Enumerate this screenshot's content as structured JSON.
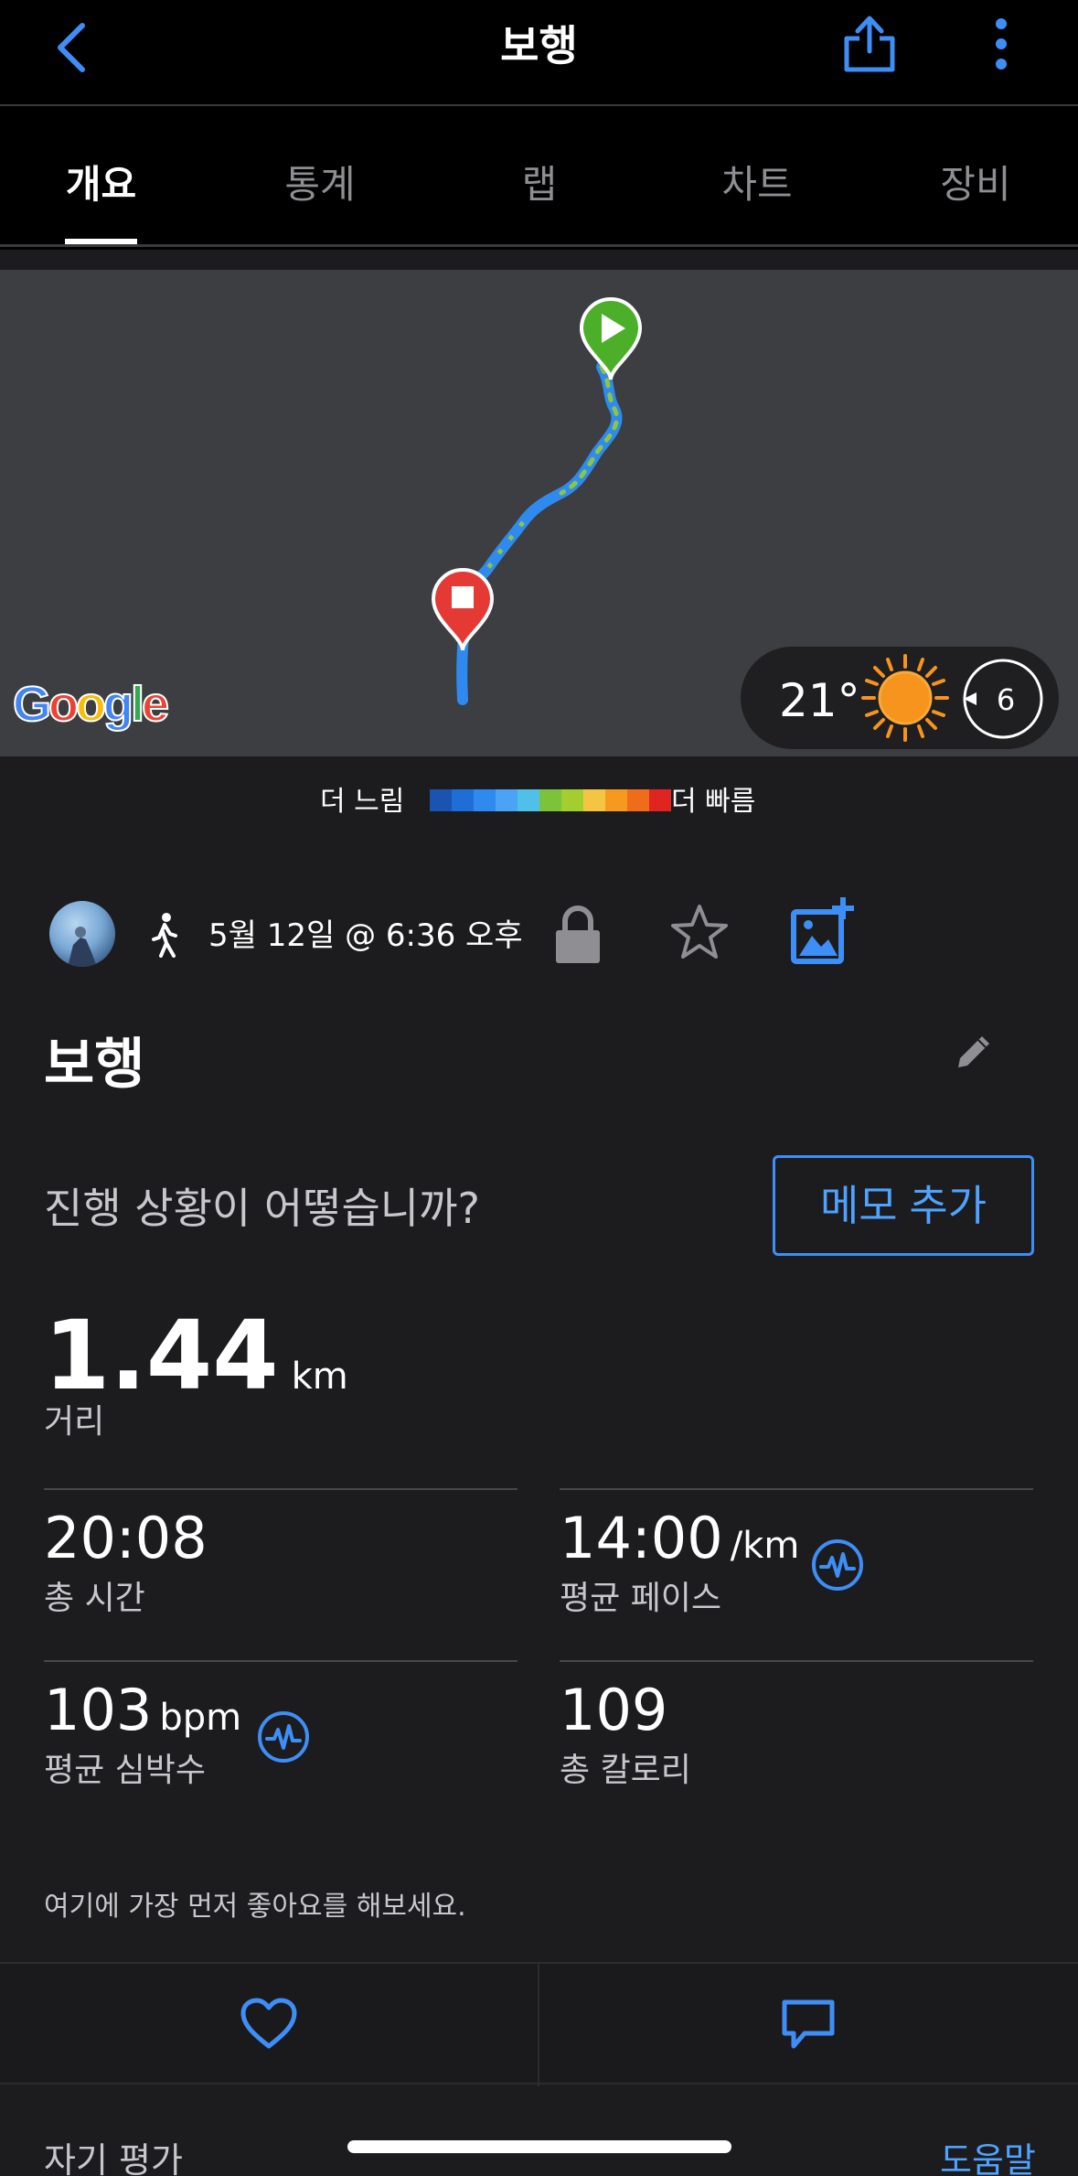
{
  "header": {
    "title": "보행",
    "back_icon": "chevron-left-icon",
    "share_icon": "share-icon",
    "more_icon": "more-vertical-icon"
  },
  "tabs": [
    {
      "label": "개요",
      "active": true
    },
    {
      "label": "통계",
      "active": false
    },
    {
      "label": "랩",
      "active": false
    },
    {
      "label": "차트",
      "active": false
    },
    {
      "label": "장비",
      "active": false
    }
  ],
  "map": {
    "google_logo": "Google",
    "weather": {
      "temperature": "21°",
      "wind": "6",
      "condition_icon": "sun-icon"
    }
  },
  "pace_legend": {
    "slow_label": "더 느림",
    "fast_label": "더 빠름",
    "colors": [
      "#1a53b0",
      "#1f6ed8",
      "#2f8af0",
      "#4aa3f5",
      "#4fc0e8",
      "#7cc23a",
      "#a3cf2e",
      "#f4c542",
      "#f59a1e",
      "#ef6c1a",
      "#e0241f"
    ]
  },
  "activity": {
    "date": "5월 12일 @ 6:36 오후",
    "title": "보행",
    "question": "진행 상황이 어떻습니까?",
    "memo_button": "메모 추가"
  },
  "stats": {
    "distance": {
      "value": "1.44",
      "unit": "km",
      "label": "거리"
    },
    "total_time": {
      "value": "20:08",
      "label": "총 시간"
    },
    "avg_pace": {
      "value": "14:00",
      "unit": "/km",
      "label": "평균 페이스"
    },
    "avg_hr": {
      "value": "103",
      "unit": "bpm",
      "label": "평균 심박수"
    },
    "calories": {
      "value": "109",
      "label": "총 칼로리"
    }
  },
  "social": {
    "likes_text": "여기에 가장 먼저 좋아요를 해보세요."
  },
  "footer": {
    "self_eval": "자기 평가",
    "help": "도움말"
  },
  "colors": {
    "accent": "#3e8ef7",
    "background": "#1c1c1e",
    "start_pin": "#4caf2a",
    "end_pin": "#e53935",
    "sun": "#f7941d"
  }
}
